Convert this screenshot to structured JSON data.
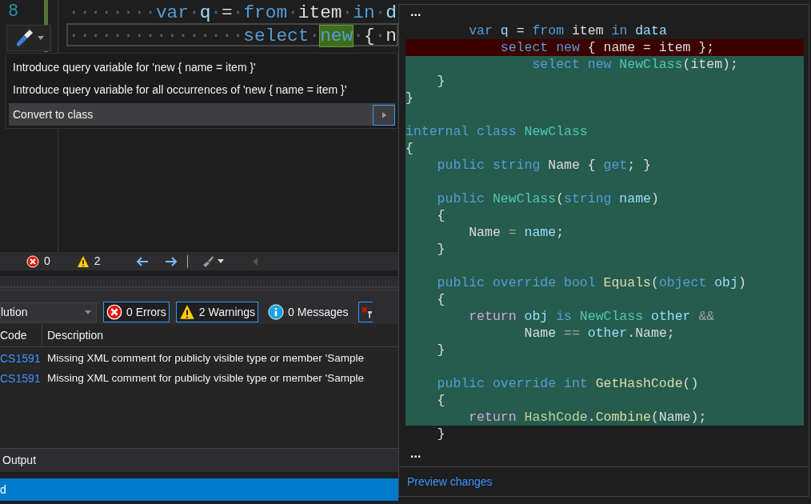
{
  "editor": {
    "line_number": "8",
    "lines": [
      {
        "current": false,
        "tokens": [
          {
            "text": "········",
            "kind": "ws",
            "highlighted": false
          },
          {
            "text": "var",
            "kind": "k",
            "highlighted": false
          },
          {
            "text": "·",
            "kind": "ws",
            "highlighted": false
          },
          {
            "text": "q",
            "kind": "v",
            "highlighted": false
          },
          {
            "text": "·",
            "kind": "ws",
            "highlighted": false
          },
          {
            "text": "=",
            "kind": "p",
            "highlighted": false
          },
          {
            "text": "·",
            "kind": "ws",
            "highlighted": false
          },
          {
            "text": "from",
            "kind": "k",
            "highlighted": false
          },
          {
            "text": "·",
            "kind": "ws",
            "highlighted": false
          },
          {
            "text": "item",
            "kind": "p",
            "highlighted": false
          },
          {
            "text": "·",
            "kind": "ws",
            "highlighted": false
          },
          {
            "text": "in",
            "kind": "k",
            "highlighted": false
          },
          {
            "text": "·",
            "kind": "ws",
            "highlighted": false
          },
          {
            "text": "d",
            "kind": "v",
            "highlighted": false
          }
        ]
      },
      {
        "current": true,
        "tokens": [
          {
            "text": "················",
            "kind": "ws",
            "highlighted": false
          },
          {
            "text": "select",
            "kind": "k",
            "highlighted": false
          },
          {
            "text": "·",
            "kind": "ws",
            "highlighted": false
          },
          {
            "text": "new",
            "kind": "k",
            "highlighted": true
          },
          {
            "text": "·",
            "kind": "ws",
            "highlighted": false
          },
          {
            "text": "{",
            "kind": "p",
            "highlighted": false
          },
          {
            "text": "·",
            "kind": "ws",
            "highlighted": false
          },
          {
            "text": "n",
            "kind": "p",
            "highlighted": false
          }
        ]
      }
    ]
  },
  "quick_actions": {
    "items": [
      {
        "label": "Introduce query variable for 'new { name = item }'",
        "selected": false,
        "has_submenu": false
      },
      {
        "label": "Introduce query variable for all occurrences of 'new { name = item }'",
        "selected": false,
        "has_submenu": false
      },
      {
        "label": "Convert to class",
        "selected": true,
        "has_submenu": true
      }
    ]
  },
  "error_toolbar": {
    "errors": "0",
    "warnings": "2"
  },
  "error_list": {
    "scope": "lution",
    "filters": [
      {
        "kind": "errors",
        "label": "0 Errors",
        "selected": true
      },
      {
        "kind": "warnings",
        "label": "2 Warnings",
        "selected": true
      },
      {
        "kind": "messages",
        "label": "0 Messages",
        "selected": false
      }
    ],
    "columns": [
      "Code",
      "Description"
    ],
    "rows": [
      {
        "code": "CS1591",
        "description": "Missing XML comment for publicly visible type or member 'Sample"
      },
      {
        "code": "CS1591",
        "description": "Missing XML comment for publicly visible type or member 'Sample"
      }
    ]
  },
  "bottom_tab": "Output",
  "status_bar": "d",
  "preview": {
    "top_ellipsis": "...",
    "bottom_ellipsis": "...",
    "link": "Preview changes",
    "lines": [
      {
        "kind": "context",
        "tokens": [
          {
            "text": "        var ",
            "kind": "k"
          },
          {
            "text": "q ",
            "kind": "v"
          },
          {
            "text": "= ",
            "kind": "p"
          },
          {
            "text": "from ",
            "kind": "k"
          },
          {
            "text": "item ",
            "kind": "p"
          },
          {
            "text": "in ",
            "kind": "k"
          },
          {
            "text": "data",
            "kind": "v"
          }
        ]
      },
      {
        "kind": "removed",
        "tokens": [
          {
            "text": "            select new ",
            "kind": "k"
          },
          {
            "text": "{ name = item };",
            "kind": "p"
          }
        ]
      },
      {
        "kind": "added",
        "tokens": [
          {
            "text": "                select new ",
            "kind": "k"
          },
          {
            "text": "NewClass",
            "kind": "t"
          },
          {
            "text": "(item);",
            "kind": "p"
          }
        ]
      },
      {
        "kind": "added",
        "tokens": [
          {
            "text": "    }",
            "kind": "p"
          }
        ]
      },
      {
        "kind": "added",
        "tokens": [
          {
            "text": "}",
            "kind": "p"
          }
        ]
      },
      {
        "kind": "added"
      },
      {
        "kind": "added",
        "tokens": [
          {
            "text": "internal class ",
            "kind": "k"
          },
          {
            "text": "NewClass",
            "kind": "t"
          }
        ]
      },
      {
        "kind": "added",
        "tokens": [
          {
            "text": "{",
            "kind": "p"
          }
        ]
      },
      {
        "kind": "added",
        "tokens": [
          {
            "text": "    public string ",
            "kind": "k"
          },
          {
            "text": "Name { ",
            "kind": "p"
          },
          {
            "text": "get",
            "kind": "k"
          },
          {
            "text": "; }",
            "kind": "p"
          }
        ]
      },
      {
        "kind": "added"
      },
      {
        "kind": "added",
        "tokens": [
          {
            "text": "    public ",
            "kind": "k"
          },
          {
            "text": "NewClass",
            "kind": "t"
          },
          {
            "text": "(",
            "kind": "p"
          },
          {
            "text": "string ",
            "kind": "k"
          },
          {
            "text": "name",
            "kind": "v"
          },
          {
            "text": ")",
            "kind": "p"
          }
        ]
      },
      {
        "kind": "added",
        "tokens": [
          {
            "text": "    {",
            "kind": "p"
          }
        ]
      },
      {
        "kind": "added",
        "tokens": [
          {
            "text": "        Name ",
            "kind": "p"
          },
          {
            "text": "= ",
            "kind": "o"
          },
          {
            "text": "name",
            "kind": "v"
          },
          {
            "text": ";",
            "kind": "p"
          }
        ]
      },
      {
        "kind": "added",
        "tokens": [
          {
            "text": "    }",
            "kind": "p"
          }
        ]
      },
      {
        "kind": "added"
      },
      {
        "kind": "added",
        "tokens": [
          {
            "text": "    public override bool ",
            "kind": "k"
          },
          {
            "text": "Equals",
            "kind": "m"
          },
          {
            "text": "(",
            "kind": "p"
          },
          {
            "text": "object ",
            "kind": "k"
          },
          {
            "text": "obj",
            "kind": "v"
          },
          {
            "text": ")",
            "kind": "p"
          }
        ]
      },
      {
        "kind": "added",
        "tokens": [
          {
            "text": "    {",
            "kind": "p"
          }
        ]
      },
      {
        "kind": "added",
        "tokens": [
          {
            "text": "        return ",
            "kind": "c"
          },
          {
            "text": "obj ",
            "kind": "v"
          },
          {
            "text": "is ",
            "kind": "k"
          },
          {
            "text": "NewClass ",
            "kind": "t"
          },
          {
            "text": "other ",
            "kind": "v"
          },
          {
            "text": "&&",
            "kind": "o"
          }
        ]
      },
      {
        "kind": "added",
        "tokens": [
          {
            "text": "               Name ",
            "kind": "p"
          },
          {
            "text": "== ",
            "kind": "o"
          },
          {
            "text": "other",
            "kind": "v"
          },
          {
            "text": ".Name;",
            "kind": "p"
          }
        ]
      },
      {
        "kind": "added",
        "tokens": [
          {
            "text": "    }",
            "kind": "p"
          }
        ]
      },
      {
        "kind": "added"
      },
      {
        "kind": "added",
        "tokens": [
          {
            "text": "    public override int ",
            "kind": "k"
          },
          {
            "text": "GetHashCode",
            "kind": "m"
          },
          {
            "text": "()",
            "kind": "p"
          }
        ]
      },
      {
        "kind": "added",
        "tokens": [
          {
            "text": "    {",
            "kind": "p"
          }
        ]
      },
      {
        "kind": "added",
        "tokens": [
          {
            "text": "        return ",
            "kind": "c"
          },
          {
            "text": "HashCode",
            "kind": "h"
          },
          {
            "text": ".",
            "kind": "p"
          },
          {
            "text": "Combine",
            "kind": "m"
          },
          {
            "text": "(Name);",
            "kind": "p"
          }
        ]
      },
      {
        "kind": "context",
        "tokens": [
          {
            "text": "    }",
            "kind": "p"
          }
        ]
      }
    ]
  }
}
